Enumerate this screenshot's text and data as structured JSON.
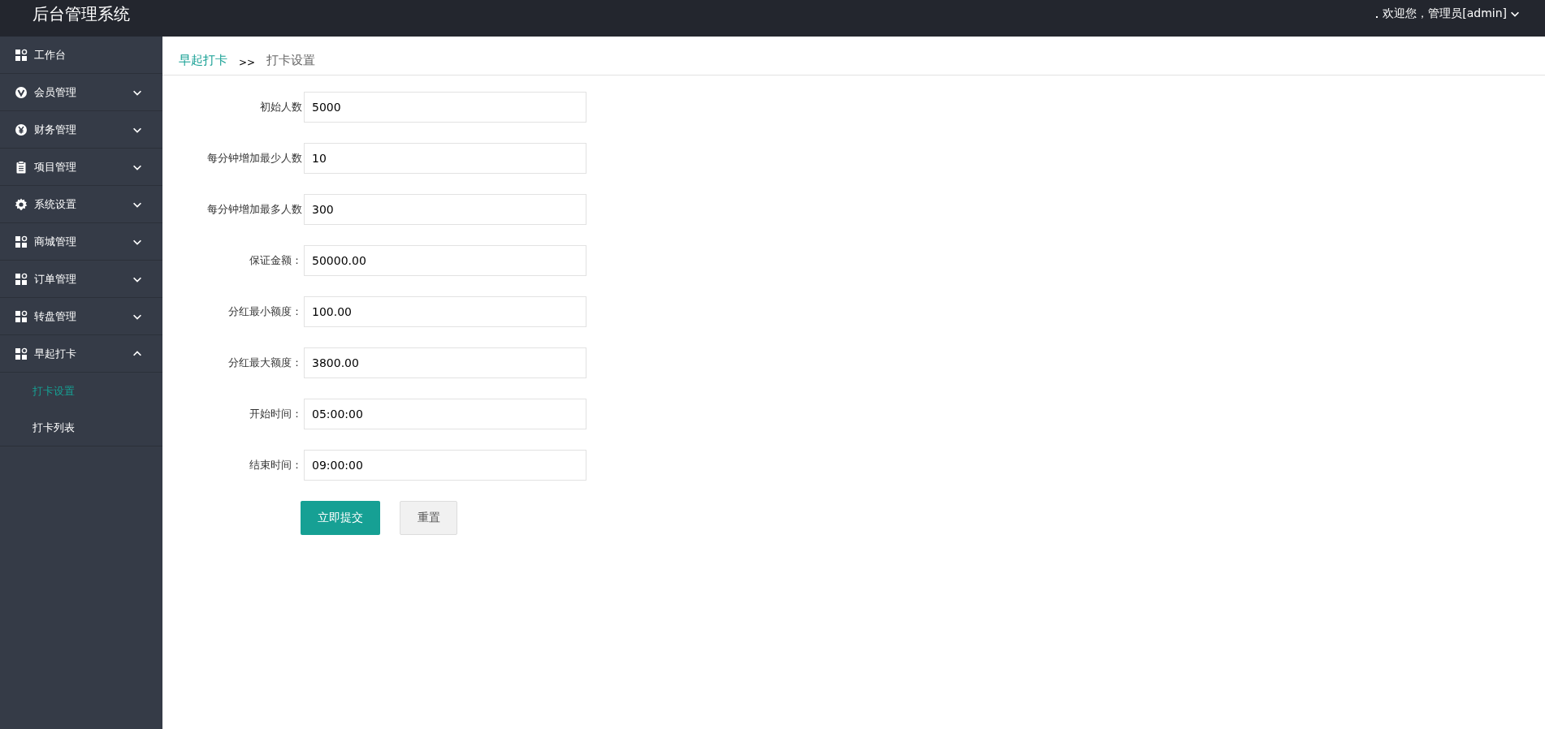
{
  "header": {
    "title": "后台管理系统",
    "user_menu": {
      "label": "欢迎您，管理员[admin]"
    }
  },
  "sidebar": {
    "items": [
      {
        "label": "工作台",
        "kind": "apps"
      },
      {
        "label": "会员管理",
        "kind": "vip",
        "expanded": false
      },
      {
        "label": "财务管理",
        "kind": "yen",
        "expanded": false
      },
      {
        "label": "项目管理",
        "kind": "clipboard",
        "expanded": false
      },
      {
        "label": "系统设置",
        "kind": "gear",
        "expanded": false
      },
      {
        "label": "商城管理",
        "kind": "apps",
        "expanded": false
      },
      {
        "label": "订单管理",
        "kind": "apps",
        "expanded": false
      },
      {
        "label": "转盘管理",
        "kind": "apps",
        "expanded": false
      },
      {
        "label": "早起打卡",
        "kind": "apps",
        "expanded": true,
        "children": [
          {
            "label": "打卡设置",
            "selected": true
          },
          {
            "label": "打卡列表",
            "selected": false
          }
        ]
      }
    ]
  },
  "breadcrumb": {
    "items": [
      "早起打卡",
      "打卡设置"
    ],
    "separator": ">>"
  },
  "form": {
    "fields": [
      {
        "label": "初始人数",
        "value": "5000"
      },
      {
        "label": "每分钟增加最少人数",
        "value": "10"
      },
      {
        "label": "每分钟增加最多人数",
        "value": "300"
      },
      {
        "label": "保证金额：",
        "value": "50000.00"
      },
      {
        "label": "分红最小额度：",
        "value": "100.00"
      },
      {
        "label": "分红最大额度：",
        "value": "3800.00"
      },
      {
        "label": "开始时间：",
        "value": "05:00:00"
      },
      {
        "label": "结束时间：",
        "value": "09:00:00"
      }
    ],
    "buttons": [
      {
        "label": "立即提交",
        "kind": "primary"
      },
      {
        "label": "重置",
        "kind": "secondary"
      }
    ]
  }
}
